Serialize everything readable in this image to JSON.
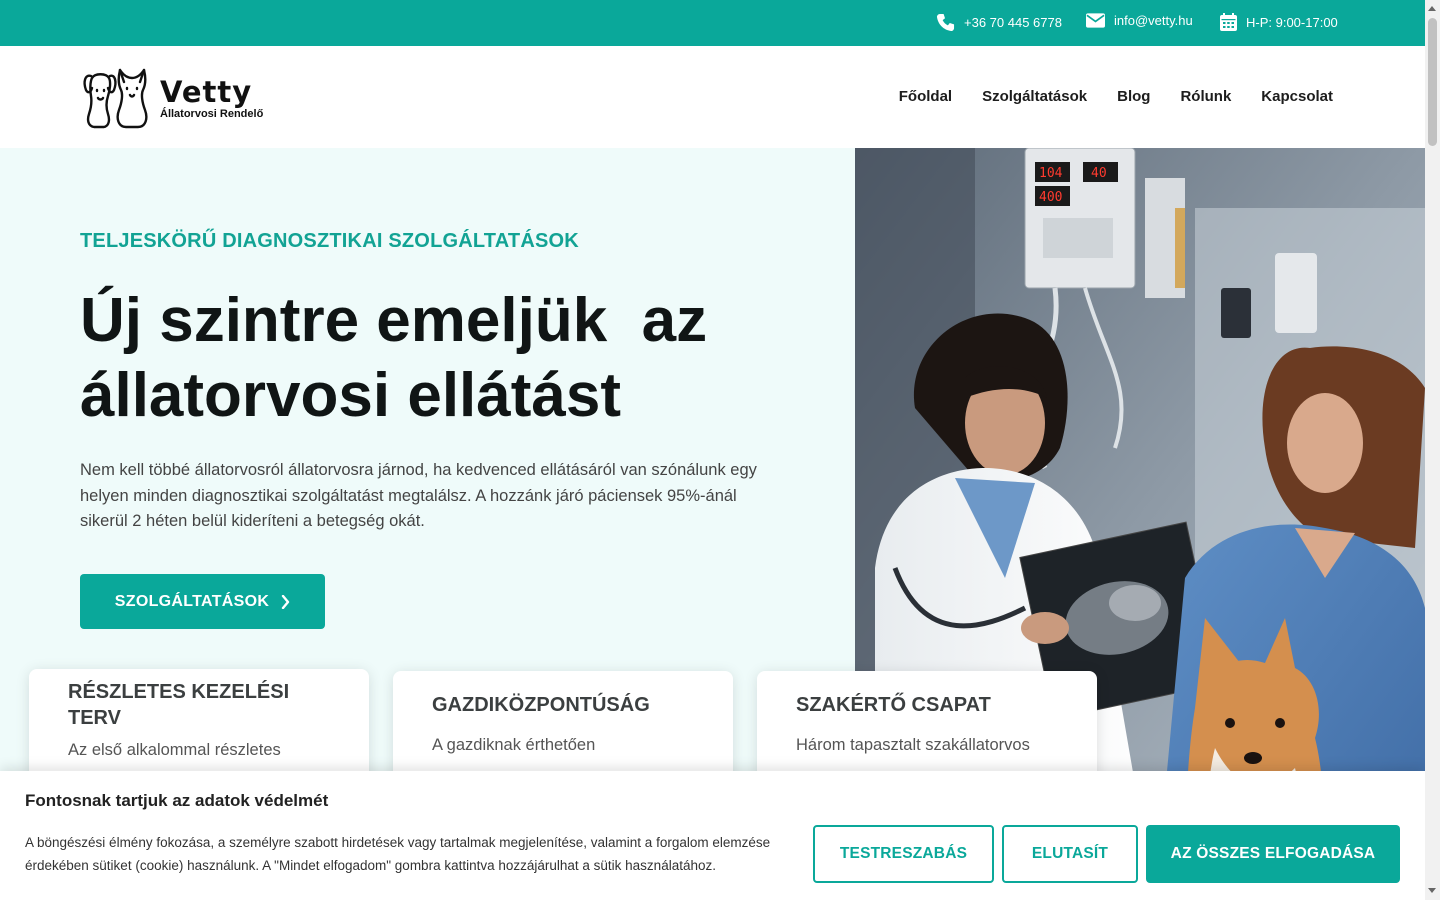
{
  "topbar": {
    "phone": "+36 70 445 6778",
    "email": "info@vetty.hu",
    "hours": "H-P: 9:00-17:00",
    "icons": [
      "phone-icon",
      "envelope-icon",
      "calendar-icon"
    ]
  },
  "logo": {
    "name": "Vetty",
    "subtitle": "Állatorvosi Rendelő"
  },
  "nav": {
    "items": [
      "Főoldal",
      "Szolgáltatások",
      "Blog",
      "Rólunk",
      "Kapcsolat"
    ]
  },
  "hero": {
    "eyebrow": "TELJESKÖRŰ DIAGNOSZTIKAI SZOLGÁLTATÁSOK",
    "headline_line1": "Új szintre emeljük  az",
    "headline_line2": "állatorvosi ellátást",
    "lead": "Nem kell többé állatorvosról állatorvosra járnod, ha kedvenced ellátásáról van szónálunk egy helyen minden diagnosztikai szolgáltatást megtalálsz. A hozzánk járó páciensek 95%-ánál sikerül 2 héten belül kideríteni a betegség okát.",
    "cta": "SZOLGÁLTATÁSOK"
  },
  "cards": [
    {
      "title": "RÉSZLETES KEZELÉSI TERV",
      "text": "Az első alkalommal részletes"
    },
    {
      "title": "GAZDIKÖZPONTÚSÁG",
      "text": "A gazdiknak érthetően"
    },
    {
      "title": "SZAKÉRTŐ CSAPAT",
      "text": "Három tapasztalt szakállatorvos"
    }
  ],
  "cookie": {
    "title": "Fontosnak tartjuk az adatok védelmét",
    "text": "A böngészési élmény fokozása, a személyre szabott hirdetések vagy tartalmak megjelenítése, valamint a forgalom elemzése érdekében sütiket (cookie) használunk. A \"Mindet elfogadom\" gombra kattintva hozzájárulhat a sütik használatához.",
    "customize": "TESTRESZABÁS",
    "reject": "ELUTASÍT",
    "accept_all": "AZ ÖSSZES ELFOGADÁSA"
  },
  "colors": {
    "accent": "#0aa89a",
    "hero_bg": "#effbfa",
    "heading": "#101515"
  }
}
